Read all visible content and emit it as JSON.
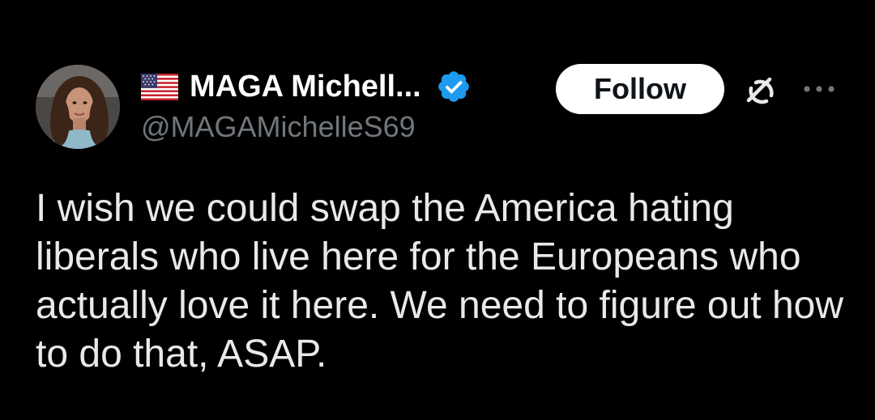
{
  "tweet": {
    "author": {
      "display_name": "MAGA Michell...",
      "handle": "@MAGAMichelleS69",
      "flag_icon": "us-flag-icon",
      "verified_icon": "verified-badge-icon",
      "verified_color": "#1d9bf0",
      "avatar_icon": "avatar-photo"
    },
    "actions": {
      "follow_label": "Follow",
      "grok_icon": "grok-icon",
      "more_icon": "more-options-icon"
    },
    "text": "I wish we could swap the America hating liberals who live here for the Europeans who actually love it here. We need to figure out how to do that, ASAP."
  },
  "colors": {
    "background": "#000000",
    "text_primary": "#e7e9ea",
    "text_secondary": "#71767b",
    "follow_bg": "#ffffff",
    "follow_text": "#0f1419"
  }
}
